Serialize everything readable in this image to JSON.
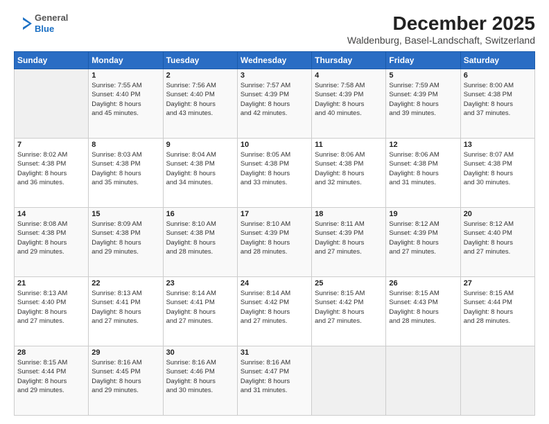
{
  "header": {
    "logo_general": "General",
    "logo_blue": "Blue",
    "title": "December 2025",
    "subtitle": "Waldenburg, Basel-Landschaft, Switzerland"
  },
  "calendar": {
    "days_of_week": [
      "Sunday",
      "Monday",
      "Tuesday",
      "Wednesday",
      "Thursday",
      "Friday",
      "Saturday"
    ],
    "weeks": [
      [
        {
          "day": "",
          "info": ""
        },
        {
          "day": "1",
          "info": "Sunrise: 7:55 AM\nSunset: 4:40 PM\nDaylight: 8 hours\nand 45 minutes."
        },
        {
          "day": "2",
          "info": "Sunrise: 7:56 AM\nSunset: 4:40 PM\nDaylight: 8 hours\nand 43 minutes."
        },
        {
          "day": "3",
          "info": "Sunrise: 7:57 AM\nSunset: 4:39 PM\nDaylight: 8 hours\nand 42 minutes."
        },
        {
          "day": "4",
          "info": "Sunrise: 7:58 AM\nSunset: 4:39 PM\nDaylight: 8 hours\nand 40 minutes."
        },
        {
          "day": "5",
          "info": "Sunrise: 7:59 AM\nSunset: 4:39 PM\nDaylight: 8 hours\nand 39 minutes."
        },
        {
          "day": "6",
          "info": "Sunrise: 8:00 AM\nSunset: 4:38 PM\nDaylight: 8 hours\nand 37 minutes."
        }
      ],
      [
        {
          "day": "7",
          "info": "Sunrise: 8:02 AM\nSunset: 4:38 PM\nDaylight: 8 hours\nand 36 minutes."
        },
        {
          "day": "8",
          "info": "Sunrise: 8:03 AM\nSunset: 4:38 PM\nDaylight: 8 hours\nand 35 minutes."
        },
        {
          "day": "9",
          "info": "Sunrise: 8:04 AM\nSunset: 4:38 PM\nDaylight: 8 hours\nand 34 minutes."
        },
        {
          "day": "10",
          "info": "Sunrise: 8:05 AM\nSunset: 4:38 PM\nDaylight: 8 hours\nand 33 minutes."
        },
        {
          "day": "11",
          "info": "Sunrise: 8:06 AM\nSunset: 4:38 PM\nDaylight: 8 hours\nand 32 minutes."
        },
        {
          "day": "12",
          "info": "Sunrise: 8:06 AM\nSunset: 4:38 PM\nDaylight: 8 hours\nand 31 minutes."
        },
        {
          "day": "13",
          "info": "Sunrise: 8:07 AM\nSunset: 4:38 PM\nDaylight: 8 hours\nand 30 minutes."
        }
      ],
      [
        {
          "day": "14",
          "info": "Sunrise: 8:08 AM\nSunset: 4:38 PM\nDaylight: 8 hours\nand 29 minutes."
        },
        {
          "day": "15",
          "info": "Sunrise: 8:09 AM\nSunset: 4:38 PM\nDaylight: 8 hours\nand 29 minutes."
        },
        {
          "day": "16",
          "info": "Sunrise: 8:10 AM\nSunset: 4:38 PM\nDaylight: 8 hours\nand 28 minutes."
        },
        {
          "day": "17",
          "info": "Sunrise: 8:10 AM\nSunset: 4:39 PM\nDaylight: 8 hours\nand 28 minutes."
        },
        {
          "day": "18",
          "info": "Sunrise: 8:11 AM\nSunset: 4:39 PM\nDaylight: 8 hours\nand 27 minutes."
        },
        {
          "day": "19",
          "info": "Sunrise: 8:12 AM\nSunset: 4:39 PM\nDaylight: 8 hours\nand 27 minutes."
        },
        {
          "day": "20",
          "info": "Sunrise: 8:12 AM\nSunset: 4:40 PM\nDaylight: 8 hours\nand 27 minutes."
        }
      ],
      [
        {
          "day": "21",
          "info": "Sunrise: 8:13 AM\nSunset: 4:40 PM\nDaylight: 8 hours\nand 27 minutes."
        },
        {
          "day": "22",
          "info": "Sunrise: 8:13 AM\nSunset: 4:41 PM\nDaylight: 8 hours\nand 27 minutes."
        },
        {
          "day": "23",
          "info": "Sunrise: 8:14 AM\nSunset: 4:41 PM\nDaylight: 8 hours\nand 27 minutes."
        },
        {
          "day": "24",
          "info": "Sunrise: 8:14 AM\nSunset: 4:42 PM\nDaylight: 8 hours\nand 27 minutes."
        },
        {
          "day": "25",
          "info": "Sunrise: 8:15 AM\nSunset: 4:42 PM\nDaylight: 8 hours\nand 27 minutes."
        },
        {
          "day": "26",
          "info": "Sunrise: 8:15 AM\nSunset: 4:43 PM\nDaylight: 8 hours\nand 28 minutes."
        },
        {
          "day": "27",
          "info": "Sunrise: 8:15 AM\nSunset: 4:44 PM\nDaylight: 8 hours\nand 28 minutes."
        }
      ],
      [
        {
          "day": "28",
          "info": "Sunrise: 8:15 AM\nSunset: 4:44 PM\nDaylight: 8 hours\nand 29 minutes."
        },
        {
          "day": "29",
          "info": "Sunrise: 8:16 AM\nSunset: 4:45 PM\nDaylight: 8 hours\nand 29 minutes."
        },
        {
          "day": "30",
          "info": "Sunrise: 8:16 AM\nSunset: 4:46 PM\nDaylight: 8 hours\nand 30 minutes."
        },
        {
          "day": "31",
          "info": "Sunrise: 8:16 AM\nSunset: 4:47 PM\nDaylight: 8 hours\nand 31 minutes."
        },
        {
          "day": "",
          "info": ""
        },
        {
          "day": "",
          "info": ""
        },
        {
          "day": "",
          "info": ""
        }
      ]
    ]
  }
}
